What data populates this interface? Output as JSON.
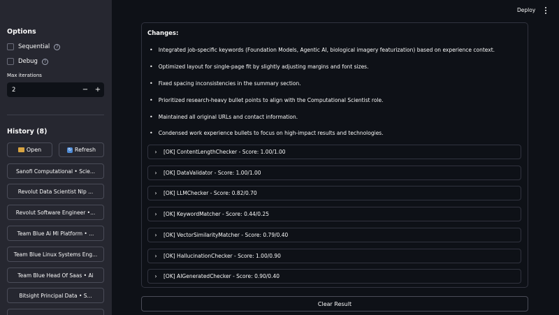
{
  "sidebar": {
    "options_title": "Options",
    "sequential_label": "Sequential",
    "debug_label": "Debug",
    "max_iterations_label": "Max iterations",
    "max_iterations_value": "2",
    "minus": "−",
    "plus": "+",
    "history_title": "History (8)",
    "open_label": "Open",
    "refresh_label": "Refresh",
    "history_items": [
      "Sanofi Computational • Scie...",
      "Revolut Data Scientist Nlp ...",
      "Revolut Software Engineer •...",
      "Team Blue Ai Ml Platform • ...",
      "Team Blue Linux Systems Eng...",
      "Team Blue Head Of Saas • Ai",
      "Bitsight Principal Data • S..."
    ]
  },
  "header": {
    "deploy_label": "Deploy"
  },
  "main": {
    "changes_title": "Changes:",
    "bullets": [
      "Integrated job-specific keywords (Foundation Models, Agentic AI, biological imagery featurization) based on experience context.",
      "Optimized layout for single-page fit by slightly adjusting margins and font sizes.",
      "Fixed spacing inconsistencies in the summary section.",
      "Prioritized research-heavy bullet points to align with the Computational Scientist role.",
      "Maintained all original URLs and contact information.",
      "Condensed work experience bullets to focus on high-impact results and technologies."
    ],
    "checkers": [
      "[OK] ContentLengthChecker - Score: 1.00/1.00",
      "[OK] DataValidator - Score: 1.00/1.00",
      "[OK] LLMChecker - Score: 0.82/0.70",
      "[OK] KeywordMatcher - Score: 0.44/0.25",
      "[OK] VectorSimilarityMatcher - Score: 0.79/0.40",
      "[OK] HallucinationChecker - Score: 1.00/0.90",
      "[OK] AIGeneratedChecker - Score: 0.90/0.40"
    ],
    "clear_label": "Clear Result"
  },
  "icons": {
    "help": "question-circle-icon",
    "folder": "folder-icon",
    "refresh": "refresh-icon",
    "chevron": "chevron-right-icon",
    "menu": "kebab-menu-icon"
  },
  "colors": {
    "background": "#0e1117",
    "sidebar": "#262730",
    "border": "#31333f",
    "text": "#fafafa"
  }
}
